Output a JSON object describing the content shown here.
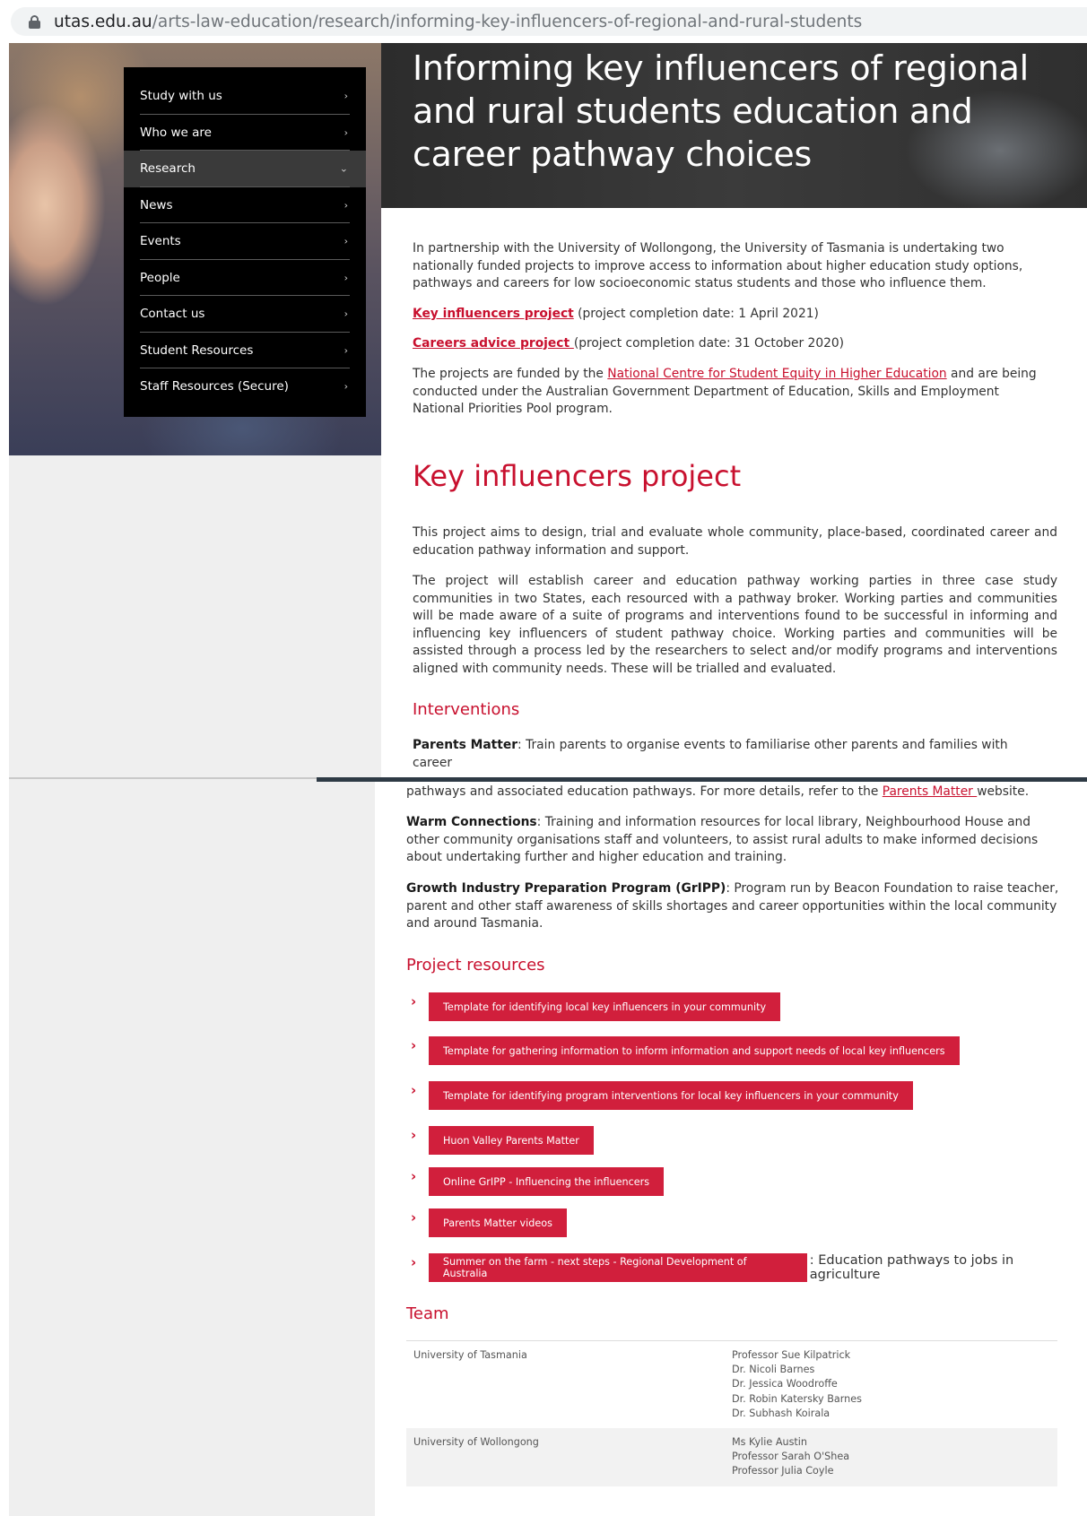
{
  "browser": {
    "url_host": "utas.edu.au",
    "url_path": "/arts-law-education/research/informing-key-influencers-of-regional-and-rural-students"
  },
  "page_title": "Informing key influencers of regional and rural students education and career pathway choices",
  "nav": {
    "items": [
      {
        "label": "Study with us",
        "chevron": "›"
      },
      {
        "label": "Who we are",
        "chevron": "›"
      },
      {
        "label": "Research",
        "chevron": "⌄"
      },
      {
        "label": "News",
        "chevron": "›"
      },
      {
        "label": "Events",
        "chevron": "›"
      },
      {
        "label": "People",
        "chevron": "›"
      },
      {
        "label": "Contact us",
        "chevron": "›"
      },
      {
        "label": "Student Resources",
        "chevron": "›"
      },
      {
        "label": "Staff Resources (Secure)",
        "chevron": "›"
      }
    ]
  },
  "intro": {
    "paragraph": "In partnership with the University of Wollongong, the University of Tasmania is undertaking two nationally funded projects to improve access to information about higher education study options, pathways and careers for low socioeconomic status students and those who influence them.",
    "key_link": "Key influencers project",
    "key_date": " (project completion date: 1 April 2021)",
    "careers_link": "Careers advice project ",
    "careers_date": "(project completion date: 31 October 2020)",
    "funded_before": "The projects are funded by the ",
    "funded_link": "National Centre for Student Equity in Higher Education",
    "funded_after": " and are being conducted under the Australian Government Department of Education, Skills and Employment National Priorities Pool program."
  },
  "key_section": {
    "heading": "Key influencers project",
    "p1": "This project aims to design, trial and evaluate whole community, place-based, coordinated career and education pathway information and support.",
    "p2": "The project will establish career and education pathway working parties in three case study communities in two States, each resourced with a pathway broker. Working parties and communities will be made aware of a suite of programs and interventions found to be successful in informing and influencing key influencers of student pathway choice. Working parties and communities will be assisted through a process led by the researchers to select and/or modify programs and interventions aligned with community needs. These will be trialled and evaluated."
  },
  "interventions": {
    "heading": "Interventions",
    "parents_name": "Parents Matter",
    "parents_text": ": Train parents to organise events to familiarise other parents and families with career pathways and associated education pathways. For more details, refer to the ",
    "parents_text_first_line": ": Train parents to organise events to familiarise other parents and families with career",
    "parents_text_repeat": "pathways and associated education pathways. For more details, refer to the ",
    "parents_link": "Parents Matter ",
    "parents_after": "website.",
    "warm_name": "Warm Connections",
    "warm_text": ": Training and information resources for local library, Neighbourhood House and other community organisations staff and volunteers, to assist rural adults to make informed decisions about undertaking further and higher education and training.",
    "gripp_name": "Growth Industry Preparation Program (GrIPP)",
    "gripp_text": ": Program run by Beacon Foundation to raise teacher, parent and other staff awareness of skills shortages and career opportunities within the local community and around Tasmania."
  },
  "resources": {
    "heading": "Project resources",
    "items": [
      {
        "label": "Template for identifying local key influencers in your  community",
        "after": ""
      },
      {
        "label": "Template for gathering information to inform information and support needs of local key influencers",
        "after": ""
      },
      {
        "label": "Template for identifying program interventions for local key influencers in your community",
        "after": ""
      },
      {
        "label": "Huon Valley Parents Matter",
        "after": ""
      },
      {
        "label": "Online GrIPP - Influencing the influencers",
        "after": ""
      },
      {
        "label": "Parents Matter videos",
        "after": ""
      },
      {
        "label": "Summer on the farm - next steps - Regional Development of Australia",
        "after": ": Education pathways to jobs in agriculture"
      }
    ],
    "chevron": "›"
  },
  "team": {
    "heading": "Team",
    "rows": [
      {
        "institution": "University of Tasmania",
        "members": [
          "Professor Sue Kilpatrick",
          "Dr. Nicoli Barnes",
          "Dr. Jessica Woodroffe",
          "Dr. Robin Katersky Barnes",
          "Dr. Subhash Koirala"
        ]
      },
      {
        "institution": "University of Wollongong",
        "members": [
          "Ms Kylie Austin",
          "Professor Sarah O'Shea",
          "Professor Julia Coyle"
        ]
      }
    ]
  }
}
